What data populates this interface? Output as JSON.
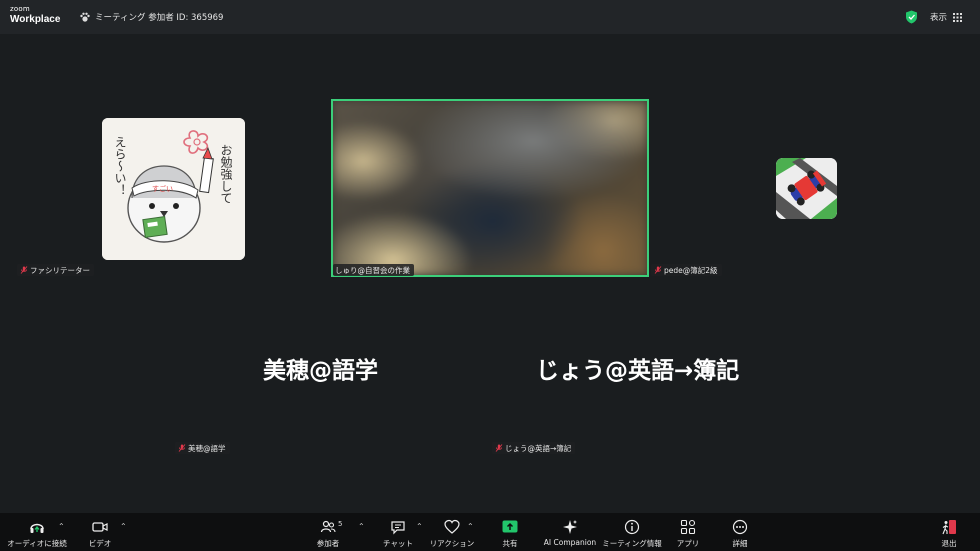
{
  "app": {
    "logo_line1": "zoom",
    "logo_line2": "Workplace",
    "meeting_info": "ミーティング 参加者 ID: 365969",
    "view_label": "表示"
  },
  "participants": {
    "left_tag": "ファシリテーター",
    "center_tag": "しゅり@自習会の作業",
    "right_tag": "pede@簿記2級",
    "mid_left_big": "美穂@語学",
    "mid_left_tag": "美穂@語学",
    "mid_right_big": "じょう@英語→簿記",
    "mid_right_tag": "じょう@英語→簿記"
  },
  "avatar_art": {
    "vertical_text_1": "お勉強して",
    "vertical_text_2": "えら～い！",
    "headband": "すごい"
  },
  "toolbar": {
    "audio": "オーディオに接続",
    "video": "ビデオ",
    "participants": "参加者",
    "participants_count": "5",
    "chat": "チャット",
    "reaction": "リアクション",
    "share": "共有",
    "ai": "AI Companion",
    "meeting_info": "ミーティング情報",
    "apps": "アプリ",
    "more": "詳細",
    "leave": "退出"
  },
  "colors": {
    "active_speaker": "#3ccf7a",
    "share_green": "#22c66b",
    "leave_red": "#e0384b",
    "muted_red": "#e0384b",
    "shield_green": "#22c66b"
  }
}
